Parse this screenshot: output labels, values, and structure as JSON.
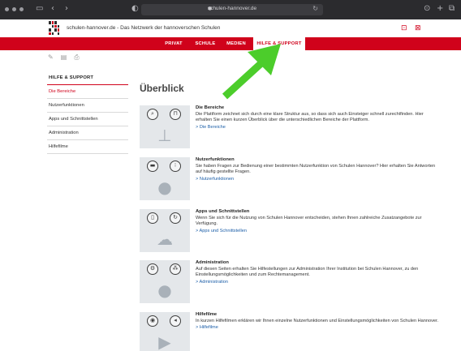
{
  "browser": {
    "url": "schulen-hannover.de",
    "back_icon": "chevron-left-icon",
    "forward_icon": "chevron-right-icon",
    "sidebar_icon": "sidebar-icon",
    "shield_icon": "shield-icon",
    "reload_icon": "reload-icon",
    "download_icon": "download-icon",
    "newtab_icon": "plus-icon",
    "tabs_icon": "tabs-icon",
    "traffic_color": "#9a9a9f"
  },
  "site": {
    "title": "schulen-hannover.de - Das Netzwerk der hannoverschen Schulen",
    "brand_color": "#d0021b",
    "header_icons": [
      "lock-icon",
      "login-icon"
    ]
  },
  "nav": {
    "items": [
      "PRIVAT",
      "SCHULE",
      "MEDIEN",
      "HILFE & SUPPORT"
    ],
    "active": "HILFE & SUPPORT"
  },
  "tools": [
    "share-icon",
    "print-preview-icon",
    "print-icon"
  ],
  "sidebar": {
    "heading": "HILFE & SUPPORT",
    "items": [
      "Die Bereiche",
      "Nutzerfunktionen",
      "Apps und Schnittstellen",
      "Administration",
      "Hilfefilme"
    ]
  },
  "main": {
    "title": "Überblick",
    "cards": [
      {
        "title": "Die Bereiche",
        "text": "Die Plattform zeichnet sich durch eine klare Struktur aus, so dass sich auch Einsteiger schnell zurechtfinden. Hier erhalten Sie einen kurzen Überblick über die unterschiedlichen Bereiche der Plattform.",
        "link": "> Die Bereiche",
        "icons": [
          "search-icon",
          "lock-icon",
          "sitemap-icon"
        ]
      },
      {
        "title": "Nutzerfunktionen",
        "text": "Sie haben Fragen zur Bedienung einer bestimmten Nutzerfunktion von Schulen Hannover? Hier erhalten Sie Antworten auf häufig gestellte Fragen.",
        "link": "> Nutzerfunktionen",
        "icons": [
          "folder-icon",
          "apps-icon",
          "user-icon"
        ]
      },
      {
        "title": "Apps und Schnittstellen",
        "text": "Wenn Sie sich für die Nutzung von Schulen Hannover entscheiden, stehen Ihnen zahlreiche Zusatzangebote zur Verfügung.",
        "link": "> Apps und Schnittstellen",
        "icons": [
          "phone-icon",
          "sync-icon",
          "cloud-icon"
        ]
      },
      {
        "title": "Administration",
        "text": "Auf diesen Seiten erhalten Sie Hilfestellungen zur Administration Ihrer Institution bei Schulen Hannover, zu den Einstellungsmöglichkeiten und zum Rechtemanagement.",
        "link": "> Administration",
        "icons": [
          "settings-icon",
          "users-icon",
          "user-gear-icon"
        ]
      },
      {
        "title": "Hilfefilme",
        "text": "In kurzen Hilfefilmen erklären wir Ihnen einzelne Nutzerfunktionen und Einstellungsmöglichkeiten von Schulen Hannover.",
        "link": "> Hilfefilme",
        "icons": [
          "eye-icon",
          "volume-icon",
          "video-icon"
        ]
      }
    ]
  },
  "annotation": {
    "arrow_color": "#4ccd2b",
    "icon": "arrow-up-right-icon"
  }
}
